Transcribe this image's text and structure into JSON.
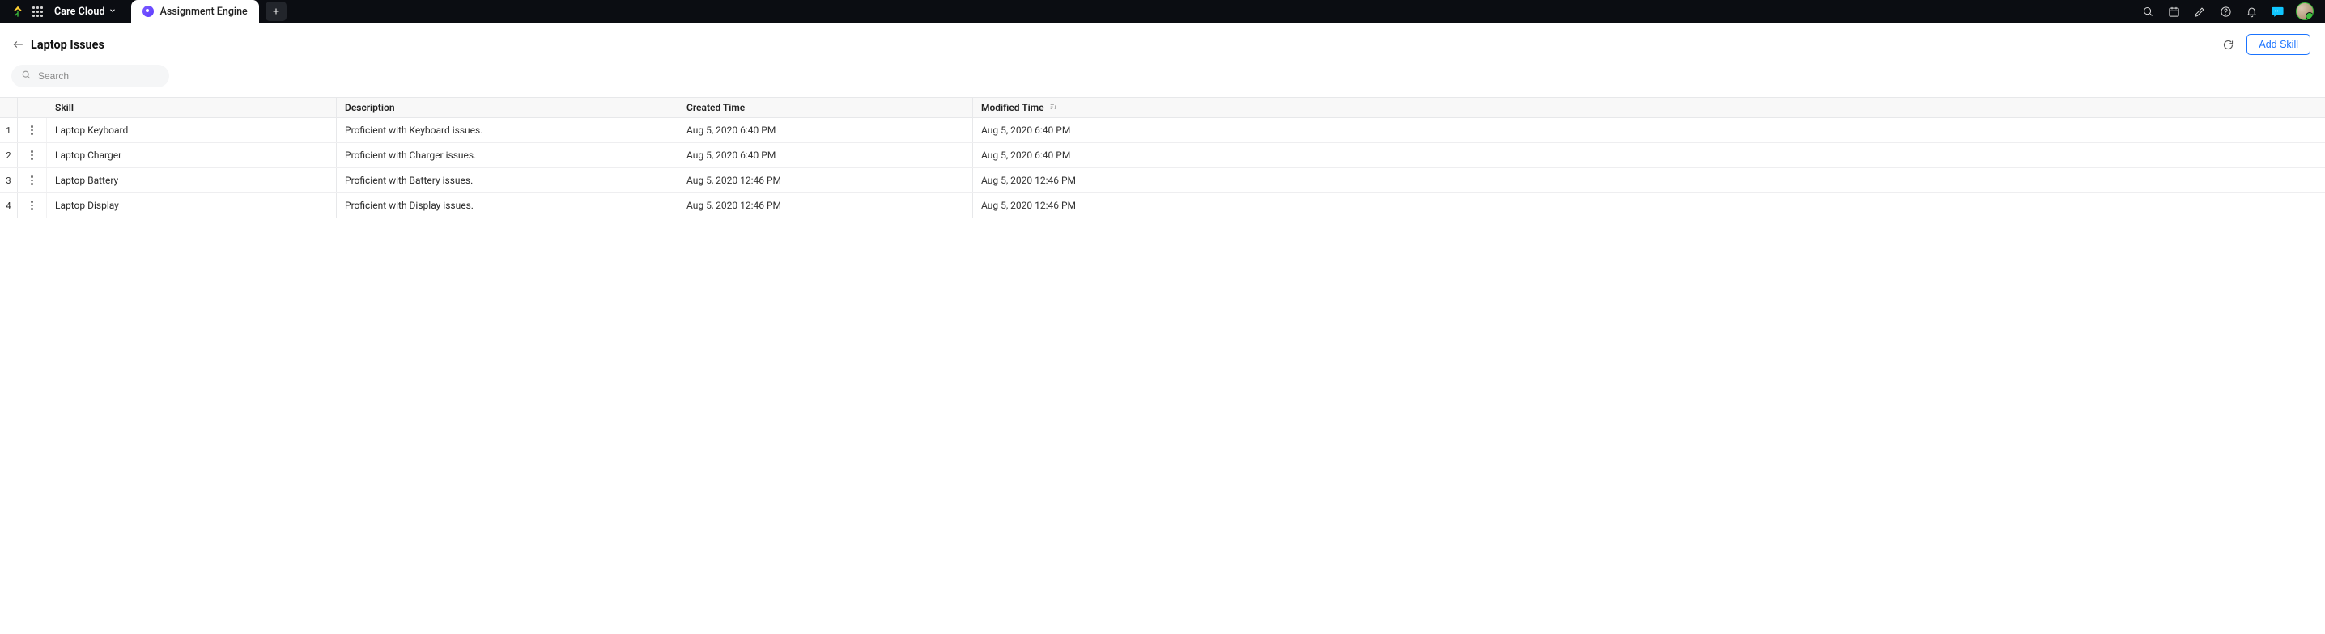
{
  "topbar": {
    "workspace_name": "Care Cloud",
    "active_tab_label": "Assignment Engine"
  },
  "page": {
    "title": "Laptop Issues",
    "add_button_label": "Add Skill"
  },
  "search": {
    "placeholder": "Search",
    "value": ""
  },
  "table": {
    "columns": {
      "skill": "Skill",
      "description": "Description",
      "created_time": "Created Time",
      "modified_time": "Modified Time"
    },
    "rows": [
      {
        "idx": "1",
        "skill": "Laptop Keyboard",
        "description": "Proficient with Keyboard issues.",
        "created": "Aug 5, 2020 6:40 PM",
        "modified": "Aug 5, 2020 6:40 PM"
      },
      {
        "idx": "2",
        "skill": "Laptop Charger",
        "description": "Proficient with Charger issues.",
        "created": "Aug 5, 2020 6:40 PM",
        "modified": "Aug 5, 2020 6:40 PM"
      },
      {
        "idx": "3",
        "skill": "Laptop Battery",
        "description": "Proficient with Battery issues.",
        "created": "Aug 5, 2020 12:46 PM",
        "modified": "Aug 5, 2020 12:46 PM"
      },
      {
        "idx": "4",
        "skill": "Laptop Display",
        "description": "Proficient with Display issues.",
        "created": "Aug 5, 2020 12:46 PM",
        "modified": "Aug 5, 2020 12:46 PM"
      }
    ]
  }
}
